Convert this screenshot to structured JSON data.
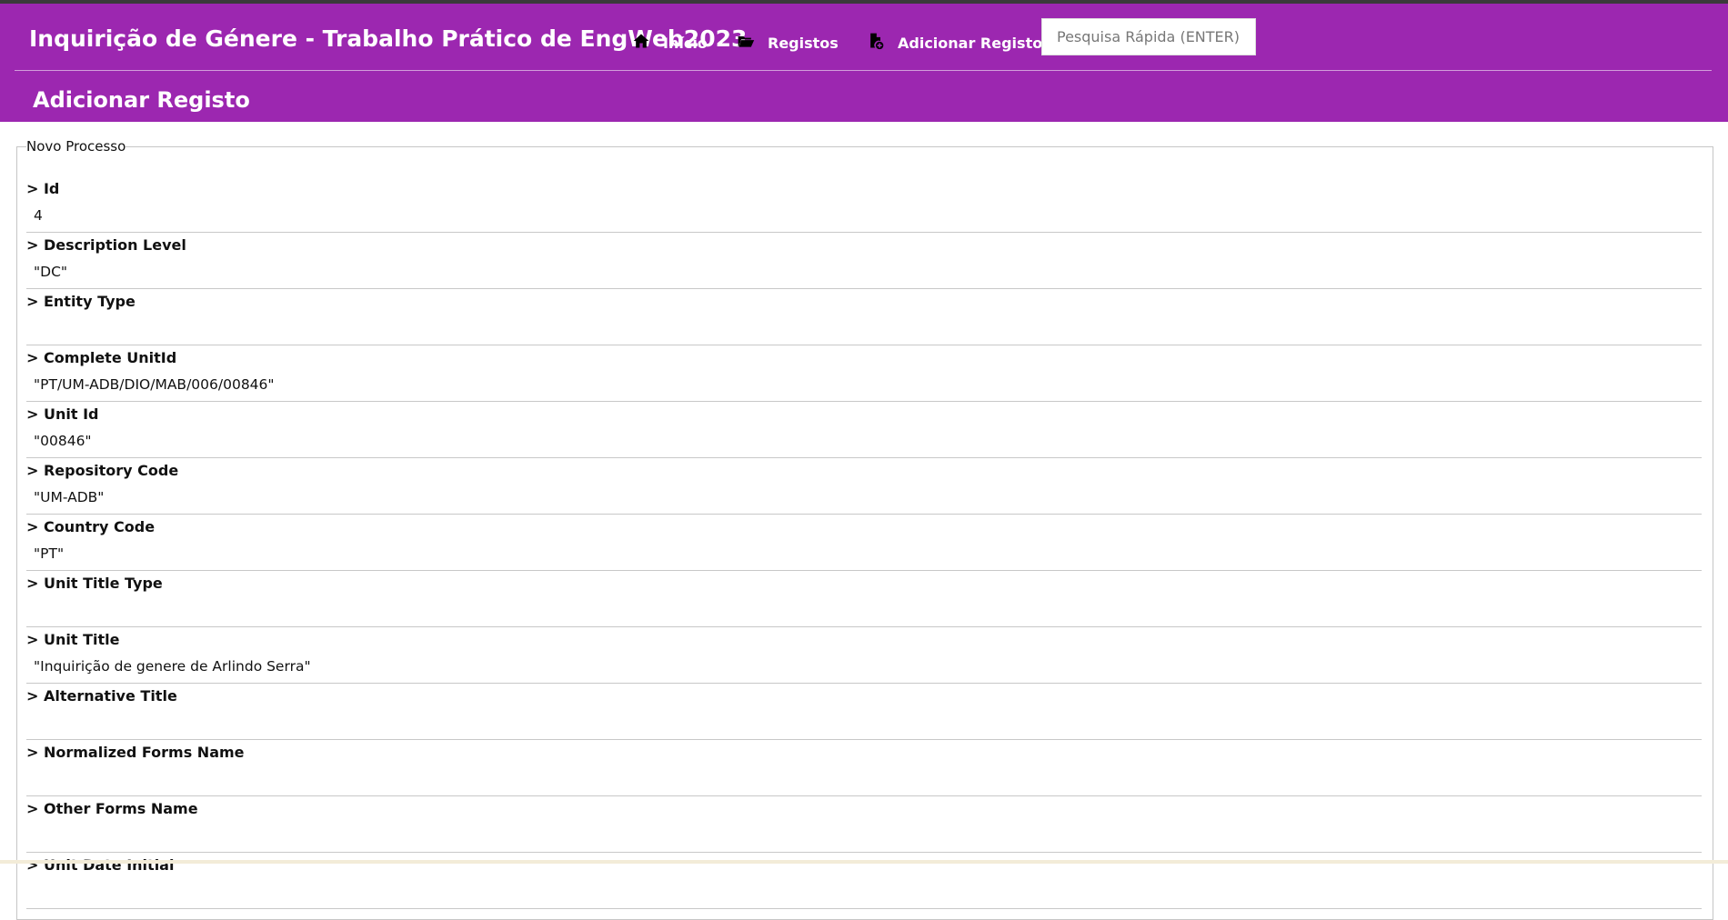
{
  "header": {
    "brand": "Inquirição de Génere - Trabalho Prático de EngWeb2023",
    "nav": [
      {
        "label": "Início",
        "icon": "home-icon"
      },
      {
        "label": "Registos",
        "icon": "folder-open-icon"
      },
      {
        "label": "Adicionar Registo",
        "icon": "file-add-icon"
      }
    ],
    "search_placeholder": "Pesquisa Rápida (ENTER)",
    "page_title": "Adicionar Registo"
  },
  "colors": {
    "accent": "#9c27b0",
    "header_text": "#ffffff"
  },
  "form": {
    "legend": "Novo Processo",
    "fields": [
      {
        "label": "> Id",
        "value": "4"
      },
      {
        "label": "> Description Level",
        "value": "\"DC\""
      },
      {
        "label": "> Entity Type",
        "value": ""
      },
      {
        "label": "> Complete UnitId",
        "value": "\"PT/UM-ADB/DIO/MAB/006/00846\""
      },
      {
        "label": "> Unit Id",
        "value": "\"00846\""
      },
      {
        "label": "> Repository Code",
        "value": "\"UM-ADB\""
      },
      {
        "label": "> Country Code",
        "value": "\"PT\""
      },
      {
        "label": "> Unit Title Type",
        "value": ""
      },
      {
        "label": "> Unit Title",
        "value": "\"Inquirição de genere de Arlindo Serra\""
      },
      {
        "label": "> Alternative Title",
        "value": ""
      },
      {
        "label": "> Normalized Forms Name",
        "value": ""
      },
      {
        "label": "> Other Forms Name",
        "value": ""
      },
      {
        "label": "> Unit Date Initial",
        "value": ""
      }
    ]
  }
}
